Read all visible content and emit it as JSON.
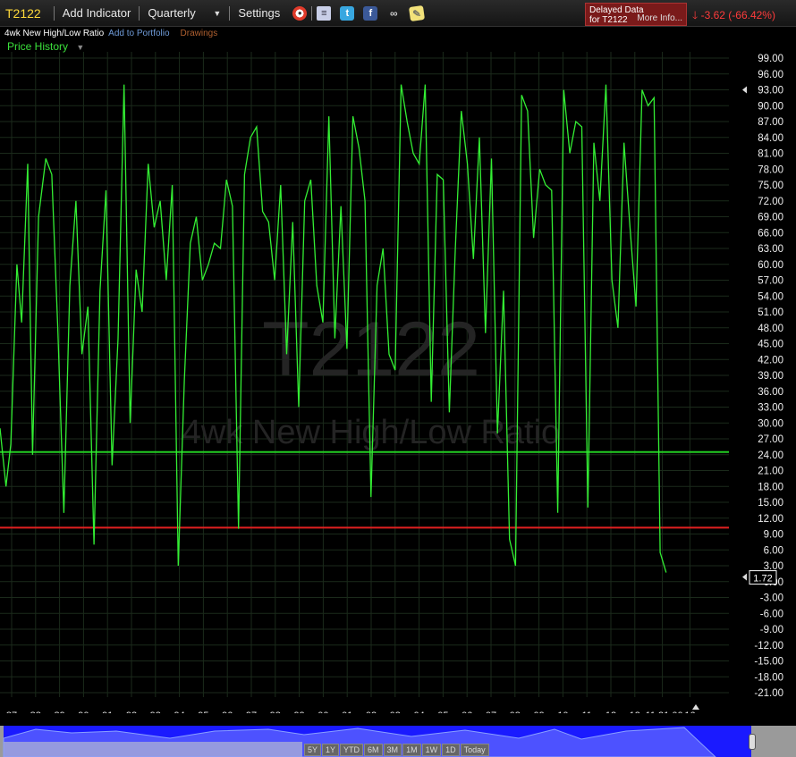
{
  "toolbar": {
    "symbol": "T2122",
    "add_indicator": "Add Indicator",
    "period": "Quarterly",
    "settings": "Settings",
    "icons": [
      "alarm-clock-icon",
      "document-icon",
      "twitter-icon",
      "facebook-icon",
      "binoculars-icon",
      "sticky-note-icon"
    ]
  },
  "status": {
    "delayed_line1": "Delayed Data",
    "delayed_line2": "for T2122",
    "more_info": "More Info...",
    "change": "-3.62 (-66.42%)"
  },
  "subrow": {
    "indicator_name": "4wk New High/Low Ratio",
    "add_to_portfolio": "Add to Portfolio",
    "drawings": "Drawings"
  },
  "price_history": "Price History",
  "watermark": {
    "symbol": "T2122",
    "name": "4wk New High/Low Ratio"
  },
  "colors": {
    "line": "#33ee33",
    "upper_threshold": "#22cc22",
    "lower_threshold": "#e02020"
  },
  "chart_data": {
    "type": "line",
    "ylim": [
      -22.5,
      100
    ],
    "y_ticks": [
      "99.00",
      "96.00",
      "93.00",
      "90.00",
      "87.00",
      "84.00",
      "81.00",
      "78.00",
      "75.00",
      "72.00",
      "69.00",
      "66.00",
      "63.00",
      "60.00",
      "57.00",
      "54.00",
      "51.00",
      "48.00",
      "45.00",
      "42.00",
      "39.00",
      "36.00",
      "33.00",
      "30.00",
      "27.00",
      "24.00",
      "21.00",
      "18.00",
      "15.00",
      "12.00",
      "9.00",
      "6.00",
      "3.00",
      "0.00",
      "-3.00",
      "-6.00",
      "-9.00",
      "-12.00",
      "-15.00",
      "-18.00",
      "-21.00"
    ],
    "x_labels": [
      "87",
      "88",
      "89",
      "90",
      "91",
      "92",
      "93",
      "94",
      "95",
      "96",
      "97",
      "98",
      "99",
      "00",
      "01",
      "02",
      "03",
      "04",
      "05",
      "06",
      "07",
      "08",
      "09",
      "10",
      "11",
      "12",
      "13",
      "11:31:00",
      "16"
    ],
    "current_value": "1.72",
    "current_value_num": 1.72,
    "marker_value": 93,
    "upper_threshold": 24.5,
    "lower_threshold": 10.2,
    "x_range": [
      1986.6,
      2016.5
    ],
    "x": [
      1986.6,
      1986.85,
      1987.05,
      1987.3,
      1987.5,
      1987.75,
      1987.95,
      1988.2,
      1988.5,
      1988.75,
      1989.0,
      1989.25,
      1989.5,
      1989.75,
      1990.0,
      1990.25,
      1990.5,
      1990.75,
      1991.0,
      1991.25,
      1991.5,
      1991.75,
      1992.0,
      1992.25,
      1992.5,
      1992.75,
      1993.0,
      1993.25,
      1993.5,
      1993.75,
      1994.0,
      1994.25,
      1994.5,
      1994.75,
      1995.0,
      1995.25,
      1995.5,
      1995.75,
      1996.0,
      1996.25,
      1996.5,
      1996.75,
      1997.0,
      1997.25,
      1997.5,
      1997.75,
      1998.0,
      1998.25,
      1998.5,
      1998.75,
      1999.0,
      1999.25,
      1999.5,
      1999.75,
      2000.0,
      2000.25,
      2000.5,
      2000.75,
      2001.0,
      2001.25,
      2001.5,
      2001.75,
      2002.0,
      2002.25,
      2002.5,
      2002.75,
      2003.0,
      2003.25,
      2003.5,
      2003.75,
      2004.0,
      2004.25,
      2004.5,
      2004.75,
      2005.0,
      2005.25,
      2005.5,
      2005.75,
      2006.0,
      2006.25,
      2006.5,
      2006.75,
      2007.0,
      2007.25,
      2007.5,
      2007.75,
      2008.0,
      2008.25,
      2008.5,
      2008.75,
      2009.0,
      2009.25,
      2009.5,
      2009.75,
      2010.0,
      2010.25,
      2010.5,
      2010.75,
      2011.0,
      2011.25,
      2011.5,
      2011.75,
      2012.0,
      2012.25,
      2012.5,
      2012.75,
      2013.0,
      2013.25,
      2013.5,
      2013.75,
      2014.0,
      2014.25,
      2014.5,
      2014.75,
      2015.0
    ],
    "values": [
      29,
      18,
      26,
      60,
      49,
      79,
      24,
      69,
      80,
      77,
      48,
      13,
      56,
      72,
      43,
      52,
      7,
      55,
      74,
      22,
      46,
      94,
      30,
      59,
      51,
      79,
      67,
      72,
      57,
      75,
      3,
      38,
      64,
      69,
      57,
      60,
      64,
      63,
      76,
      71,
      10,
      77,
      84,
      86,
      70,
      68,
      57,
      75,
      43,
      68,
      33,
      72,
      76,
      56,
      49,
      88,
      46,
      71,
      44,
      88,
      82,
      72,
      16,
      56,
      63,
      43,
      40,
      94,
      87,
      81,
      79,
      94,
      34,
      77,
      76,
      32,
      63,
      89,
      79,
      61,
      84,
      47,
      80,
      28,
      55,
      8,
      3,
      92,
      89,
      65,
      78,
      75,
      74,
      13,
      93,
      81,
      87,
      86,
      14,
      83,
      72,
      94,
      57,
      48,
      83,
      67,
      52,
      93,
      90,
      91.5,
      5.5,
      1.72
    ]
  }
}
